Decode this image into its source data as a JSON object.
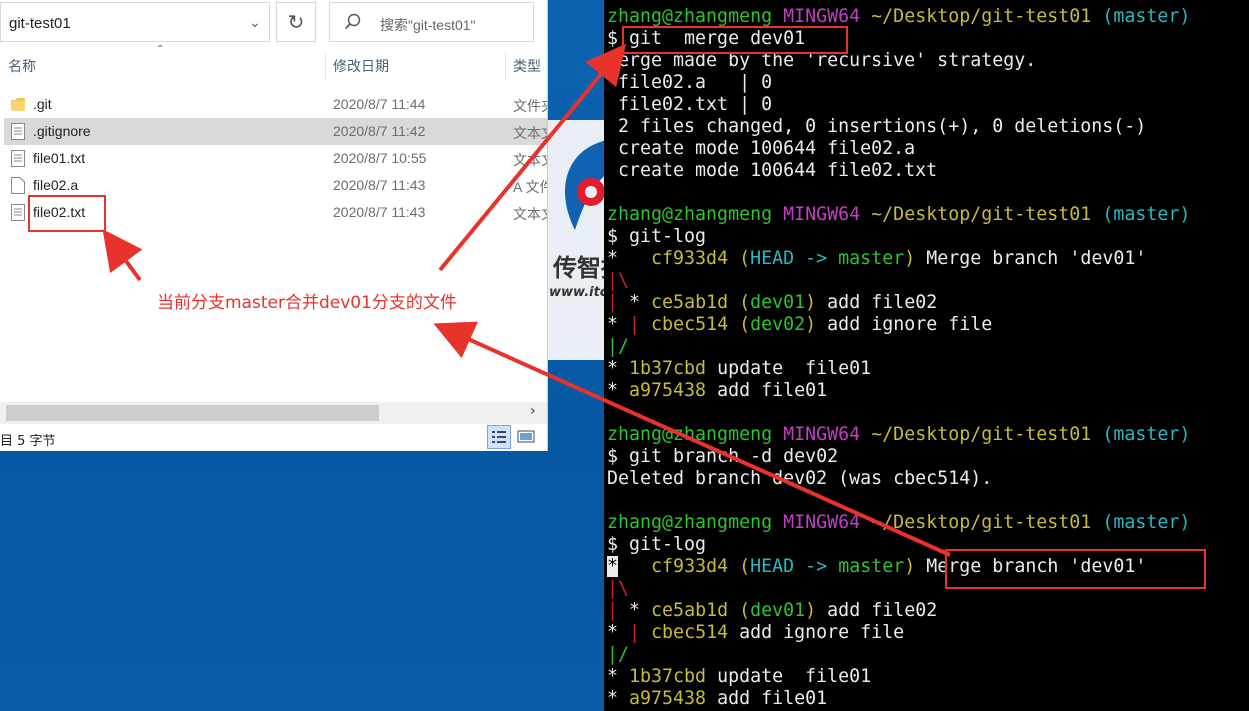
{
  "explorer": {
    "address": "git-test01",
    "search_placeholder": "搜索\"git-test01\"",
    "columns": {
      "name": "名称",
      "date": "修改日期",
      "type": "类型"
    },
    "files": [
      {
        "name": ".git",
        "date": "2020/8/7 11:44",
        "type": "文件夹",
        "icon": "folder-icon"
      },
      {
        "name": ".gitignore",
        "date": "2020/8/7 11:42",
        "type": "文本文档",
        "icon": "text-file-icon"
      },
      {
        "name": "file01.txt",
        "date": "2020/8/7 10:55",
        "type": "文本文档",
        "icon": "text-file-icon"
      },
      {
        "name": "file02.a",
        "date": "2020/8/7 11:43",
        "type": "A 文件",
        "icon": "blank-file-icon"
      },
      {
        "name": "file02.txt",
        "date": "2020/8/7 11:43",
        "type": "文本文档",
        "icon": "text-file-icon"
      }
    ],
    "status": "目 5 字节"
  },
  "annotation": {
    "text": "当前分支master合并dev01分支的文件",
    "color": "#e8322c"
  },
  "watermark": {
    "brand": "传智播",
    "url": "www.itcas"
  },
  "terminal": {
    "prompt": {
      "user": "zhang@zhangmeng",
      "system": "MINGW64",
      "path": "~/Desktop/git-test01",
      "branch": "(master)"
    },
    "block1": {
      "cmd": "$ git  merge dev01",
      "output": [
        "Merge made by the 'recursive' strategy.",
        " file02.a   | 0",
        " file02.txt | 0",
        " 2 files changed, 0 insertions(+), 0 deletions(-)",
        " create mode 100644 file02.a",
        " create mode 100644 file02.txt"
      ]
    },
    "block2": {
      "cmd": "$ git-log",
      "log": {
        "l1_hash": "cf933d4",
        "l1_head": "(HEAD -> master)",
        "l1_msg": " Merge branch 'dev01'",
        "l3_hash": "ce5ab1d",
        "l3_ref": "(dev01)",
        "l3_msg": " add file02",
        "l4_hash": "cbec514",
        "l4_ref": "(dev02)",
        "l4_msg": " add ignore file",
        "l6_hash": "1b37cbd",
        "l6_msg": " update  file01",
        "l7_hash": "a975438",
        "l7_msg": " add file01"
      }
    },
    "block3": {
      "cmd": "$ git branch -d dev02",
      "output": "Deleted branch dev02 (was cbec514)."
    },
    "block4": {
      "cmd": "$ git-log",
      "log": {
        "l1_hash": "cf933d4",
        "l1_head": "(HEAD -> master)",
        "l1_msg": "Merge branch 'dev01'",
        "l3_hash": "ce5ab1d",
        "l3_ref": "(dev01)",
        "l3_msg": " add file02",
        "l4_hash": "cbec514",
        "l4_msg": " add ignore file",
        "l6_hash": "1b37cbd",
        "l6_msg": " update  file01",
        "l7_hash": "a975438",
        "l7_msg": " add file01"
      }
    },
    "colors": {
      "green": "#2fc32f",
      "magenta": "#c13fc1",
      "yellow": "#c8bb3b",
      "cyan": "#2bb6c1",
      "red": "#c0272d"
    }
  }
}
